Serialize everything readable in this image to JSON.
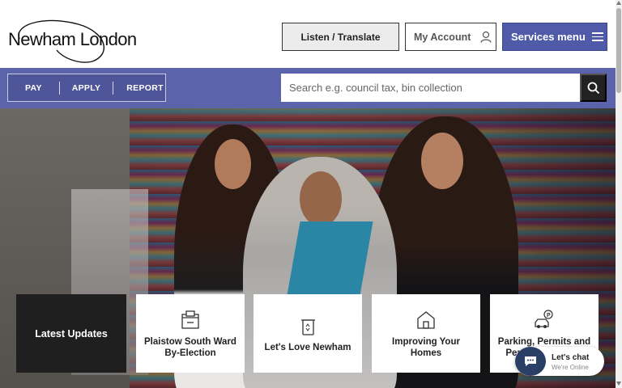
{
  "header": {
    "logo_text": "Newham London",
    "listen_label": "Listen / Translate",
    "account_label": "My Account",
    "services_label": "Services menu"
  },
  "nav": {
    "quick_links": [
      "PAY",
      "APPLY",
      "REPORT"
    ],
    "search_placeholder": "Search e.g. council tax, bin collection"
  },
  "cards": [
    {
      "label": "Latest Updates",
      "icon": "none"
    },
    {
      "label": "Plaistow South Ward By-Election",
      "icon": "ballot-box-icon"
    },
    {
      "label": "Let's Love Newham",
      "icon": "recycling-bin-icon"
    },
    {
      "label": "Improving Your Homes",
      "icon": "house-icon"
    },
    {
      "label": "Parking, Permits and Penalty Charge N",
      "icon": "parking-car-icon"
    }
  ],
  "chat": {
    "title": "Let's chat",
    "status": "We're Online"
  },
  "colors": {
    "brand_blue": "#5b63ab",
    "services_button": "#4f5aa8",
    "dark_tile": "#1f1f1f"
  }
}
